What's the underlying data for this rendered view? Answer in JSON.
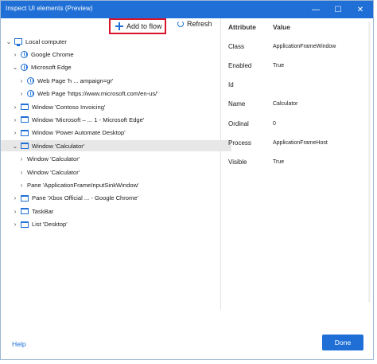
{
  "window": {
    "title": "Inspect UI elements (Preview)",
    "controls": {
      "minimize": "—",
      "maximize": "☐",
      "close": "✕"
    }
  },
  "toolbar": {
    "add_label": "Add to flow",
    "refresh_label": "Refresh"
  },
  "tree": {
    "items": [
      {
        "label": "Local computer",
        "icon": "monitor-icon",
        "expand": "chevron-down",
        "level": 0
      },
      {
        "label": "Google Chrome",
        "icon": "globe-icon",
        "expand": "chevron-right",
        "level": 1
      },
      {
        "label": "Microsoft Edge",
        "icon": "globe-icon",
        "expand": "chevron-down",
        "level": 1
      },
      {
        "label": "Web Page 'h ... ampaign=gr'",
        "icon": "globe-icon",
        "expand": "chevron-right",
        "level": 2
      },
      {
        "label": "Web Page 'https://www.microsoft.com/en-us/'",
        "icon": "globe-icon",
        "expand": "chevron-right",
        "level": 2
      },
      {
        "label": "Window 'Contoso Invoicing'",
        "icon": "window-icon",
        "expand": "chevron-right",
        "level": 1
      },
      {
        "label": "Window 'Microsoft – ... 1 - Microsoft Edge'",
        "icon": "window-icon",
        "expand": "chevron-right",
        "level": 1
      },
      {
        "label": "Window 'Power Automate Desktop'",
        "icon": "window-icon",
        "expand": "chevron-right",
        "level": 1
      },
      {
        "label": "Window 'Calculator'",
        "icon": "window-icon",
        "expand": "chevron-down",
        "level": 1,
        "selected": true
      },
      {
        "label": "Window 'Calculator'",
        "icon": "",
        "expand": "chevron-right",
        "level": 2
      },
      {
        "label": "Window 'Calculator'",
        "icon": "",
        "expand": "chevron-right",
        "level": 2
      },
      {
        "label": "Pane 'ApplicationFrameInputSinkWindow'",
        "icon": "",
        "expand": "chevron-right",
        "level": 2
      },
      {
        "label": "Pane 'Xbox Official ... - Google Chrome'",
        "icon": "window-icon",
        "expand": "chevron-right",
        "level": 1
      },
      {
        "label": "TaskBar",
        "icon": "window-icon",
        "expand": "chevron-right",
        "level": 1
      },
      {
        "label": "List 'Desktop'",
        "icon": "window-icon",
        "expand": "chevron-right",
        "level": 1
      }
    ]
  },
  "properties": {
    "headers": {
      "attribute": "Attribute",
      "value": "Value"
    },
    "rows": [
      {
        "key": "Class",
        "value": "ApplicationFrameWindow"
      },
      {
        "key": "Enabled",
        "value": "True"
      },
      {
        "key": "Id",
        "value": ""
      },
      {
        "key": "Name",
        "value": "Calculator"
      },
      {
        "key": "Ordinal",
        "value": "0"
      },
      {
        "key": "Process",
        "value": "ApplicationFrameHost"
      },
      {
        "key": "Visible",
        "value": "True"
      }
    ]
  },
  "footer": {
    "help_label": "Help",
    "done_label": "Done"
  },
  "colors": {
    "accent": "#1f6fd6",
    "highlight_border": "#d9142a",
    "selected_row": "#e7e7e7"
  }
}
